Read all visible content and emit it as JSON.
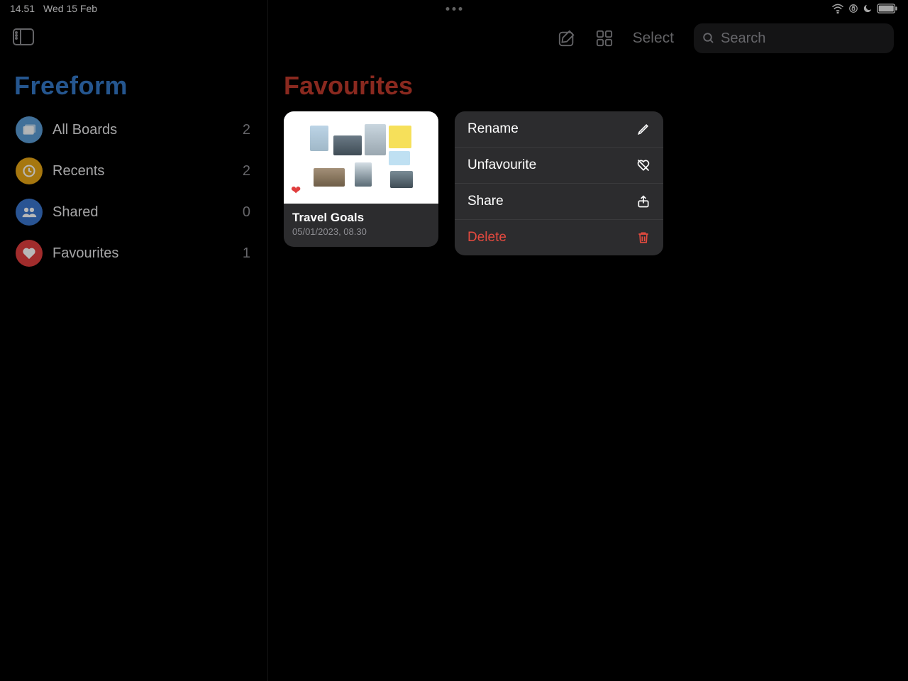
{
  "status": {
    "time": "14.51",
    "date": "Wed 15 Feb"
  },
  "app": {
    "title": "Freeform"
  },
  "sidebar": {
    "items": [
      {
        "label": "All Boards",
        "count": "2"
      },
      {
        "label": "Recents",
        "count": "2"
      },
      {
        "label": "Shared",
        "count": "0"
      },
      {
        "label": "Favourites",
        "count": "1"
      }
    ]
  },
  "toolbar": {
    "select_label": "Select",
    "search_placeholder": "Search"
  },
  "main": {
    "title": "Favourites"
  },
  "board": {
    "title": "Travel Goals",
    "date": "05/01/2023, 08.30"
  },
  "context_menu": {
    "rename": "Rename",
    "unfavourite": "Unfavourite",
    "share": "Share",
    "delete": "Delete"
  }
}
